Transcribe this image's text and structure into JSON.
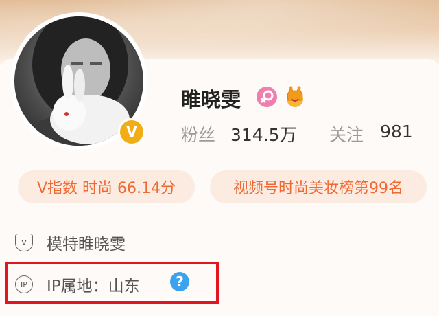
{
  "profile": {
    "username": "睢晓雯",
    "verified_mark": "V",
    "gender_icon": "female-icon",
    "vip_icon": "crown-icon"
  },
  "stats": {
    "followers_label": "粉丝",
    "followers_value": "314.5万",
    "following_label": "关注",
    "following_value": "981"
  },
  "tags": [
    {
      "label": "V指数 时尚 66.14分"
    },
    {
      "label": "视频号时尚美妆榜第99名"
    }
  ],
  "info": {
    "verification_icon_text": "V",
    "verification": "模特睢晓雯",
    "ip_icon_text": "IP",
    "ip_location": "IP属地：山东",
    "help_mark": "?"
  },
  "colors": {
    "tag_bg": "#fcebe1",
    "tag_text": "#ee6a35",
    "verified_badge": "#f2ad16",
    "help_icon": "#3aa2ee",
    "highlight": "#e2141f"
  }
}
